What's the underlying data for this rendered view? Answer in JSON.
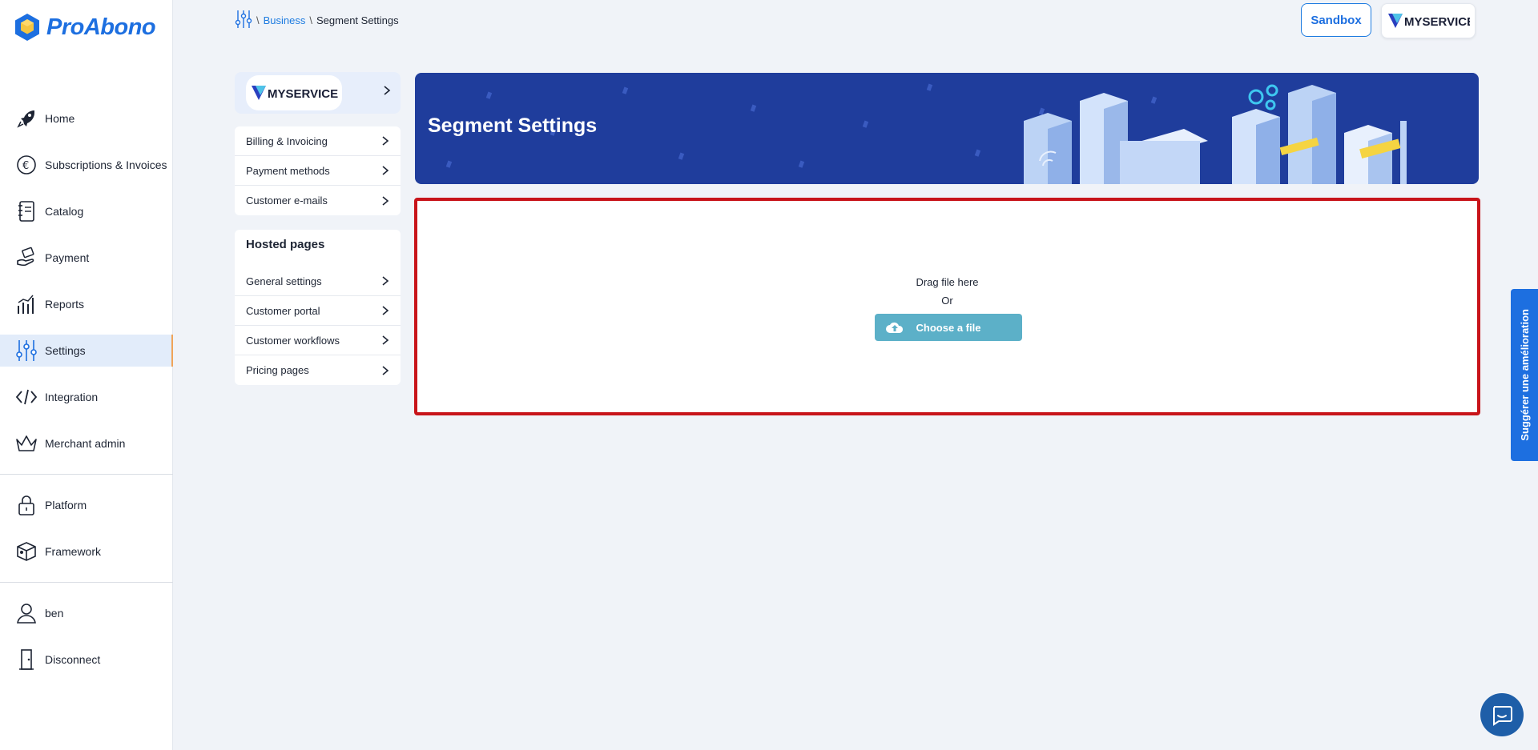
{
  "app": {
    "name": "ProAbono"
  },
  "sidebar": {
    "items": [
      {
        "label": "Home",
        "icon": "rocket-icon"
      },
      {
        "label": "Subscriptions & Invoices",
        "icon": "euro-cycle-icon"
      },
      {
        "label": "Catalog",
        "icon": "notebook-icon"
      },
      {
        "label": "Payment",
        "icon": "hand-money-icon"
      },
      {
        "label": "Reports",
        "icon": "chart-icon"
      },
      {
        "label": "Settings",
        "icon": "sliders-icon",
        "active": true
      },
      {
        "label": "Integration",
        "icon": "code-icon"
      },
      {
        "label": "Merchant admin",
        "icon": "crown-icon"
      },
      {
        "label": "Platform",
        "icon": "lock-icon"
      },
      {
        "label": "Framework",
        "icon": "box-icon"
      },
      {
        "label": "ben",
        "icon": "user-icon"
      },
      {
        "label": "Disconnect",
        "icon": "door-icon"
      }
    ]
  },
  "breadcrumb": {
    "sep": "\\",
    "business": "Business",
    "current": "Segment Settings"
  },
  "header": {
    "sandbox_label": "Sandbox",
    "brand_name": "MYSERVICE"
  },
  "submenu": {
    "brand_name": "MYSERVICE",
    "group1": [
      "Billing & Invoicing",
      "Payment methods",
      "Customer e-mails"
    ],
    "hosted_title": "Hosted pages",
    "group2": [
      "General settings",
      "Customer portal",
      "Customer workflows",
      "Pricing pages"
    ]
  },
  "banner": {
    "title": "Segment Settings"
  },
  "upload": {
    "drag_text": "Drag file here",
    "or_text": "Or",
    "choose_label": "Choose a file"
  },
  "feedback": {
    "label": "Suggérer une amélioration"
  },
  "colors": {
    "primary": "#1d6fe0",
    "banner": "#1f3d9c",
    "highlight": "#c8141a",
    "upload_button": "#5cb0c8"
  }
}
